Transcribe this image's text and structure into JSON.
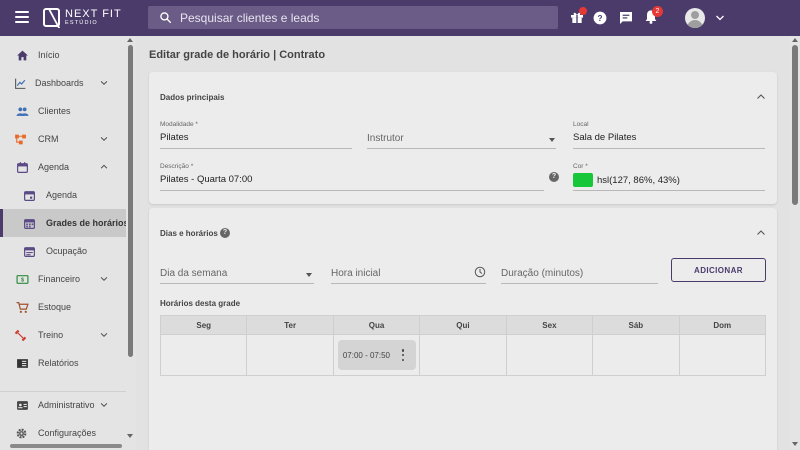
{
  "brand": {
    "name": "NEXT FIT",
    "subtitle": "ESTÚDIO",
    "header_color": "#4b3b6b"
  },
  "search": {
    "placeholder": "Pesquisar clientes e leads"
  },
  "topbar": {
    "notifications_count": "2"
  },
  "sidebar": {
    "items": [
      {
        "label": "Início",
        "icon": "home-icon"
      },
      {
        "label": "Dashboards",
        "icon": "chart-line-icon",
        "expandable": true
      },
      {
        "label": "Clientes",
        "icon": "people-icon"
      },
      {
        "label": "CRM",
        "icon": "crm-icon",
        "expandable": true
      },
      {
        "label": "Agenda",
        "icon": "calendar-icon",
        "expanded": true
      },
      {
        "label": "Agenda",
        "icon": "calendar-event-icon",
        "sub": true
      },
      {
        "label": "Grades de horários",
        "icon": "calendar-grid-icon",
        "sub": true,
        "active": true
      },
      {
        "label": "Ocupação",
        "icon": "calendar-list-icon",
        "sub": true
      },
      {
        "label": "Financeiro",
        "icon": "money-icon",
        "expandable": true
      },
      {
        "label": "Estoque",
        "icon": "cart-icon"
      },
      {
        "label": "Treino",
        "icon": "dumbbell-icon",
        "expandable": true
      },
      {
        "label": "Relatórios",
        "icon": "report-icon"
      },
      {
        "label": "Administrativo",
        "icon": "id-card-icon",
        "expandable": true
      },
      {
        "label": "Configurações",
        "icon": "gear-icon"
      }
    ]
  },
  "page": {
    "title": "Editar grade de horário | Contrato"
  },
  "main_card": {
    "title": "Dados principais",
    "modalidade": {
      "label": "Modalidade *",
      "value": "Pilates"
    },
    "instrutor": {
      "placeholder": "Instrutor"
    },
    "local": {
      "label": "Local",
      "value": "Sala de Pilates"
    },
    "descricao": {
      "label": "Descrição *",
      "value": "Pilates - Quarta 07:00"
    },
    "cor": {
      "label": "Cor *",
      "value": "hsl(127, 86%, 43%)",
      "swatch": "#17c739"
    }
  },
  "days_card": {
    "title": "Dias e horários",
    "dia_semana": {
      "placeholder": "Dia da semana"
    },
    "hora_inicial": {
      "placeholder": "Hora inicial"
    },
    "duracao": {
      "placeholder": "Duração (minutos)"
    },
    "add_button": "ADICIONAR",
    "schedule_title": "Horários desta grade",
    "days": [
      "Seg",
      "Ter",
      "Qua",
      "Qui",
      "Sex",
      "Sáb",
      "Dom"
    ],
    "slots": [
      {
        "day": "Qua",
        "time": "07:00 - 07:50"
      }
    ]
  }
}
